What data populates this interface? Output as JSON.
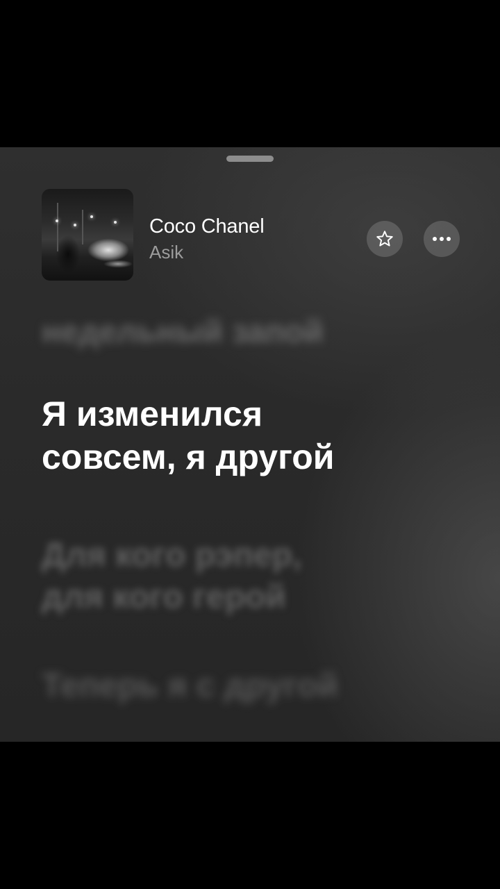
{
  "now_playing": {
    "title": "Coco Chanel",
    "artist": "Asik",
    "artwork": "album-artwork-night-car"
  },
  "actions": {
    "favorite_icon": "star-icon",
    "more_icon": "ellipsis-icon"
  },
  "lyrics": {
    "previous": "недельный запой",
    "current_line1": "Я изменился",
    "current_line2": "совсем, я другой",
    "next_line1": "Для кого рэпер,",
    "next_line2": "для кого герой",
    "after": "Теперь я с другой"
  },
  "colors": {
    "background": "#2b2b2b",
    "active_lyric": "#ffffff",
    "artist": "#9c9c9c"
  }
}
